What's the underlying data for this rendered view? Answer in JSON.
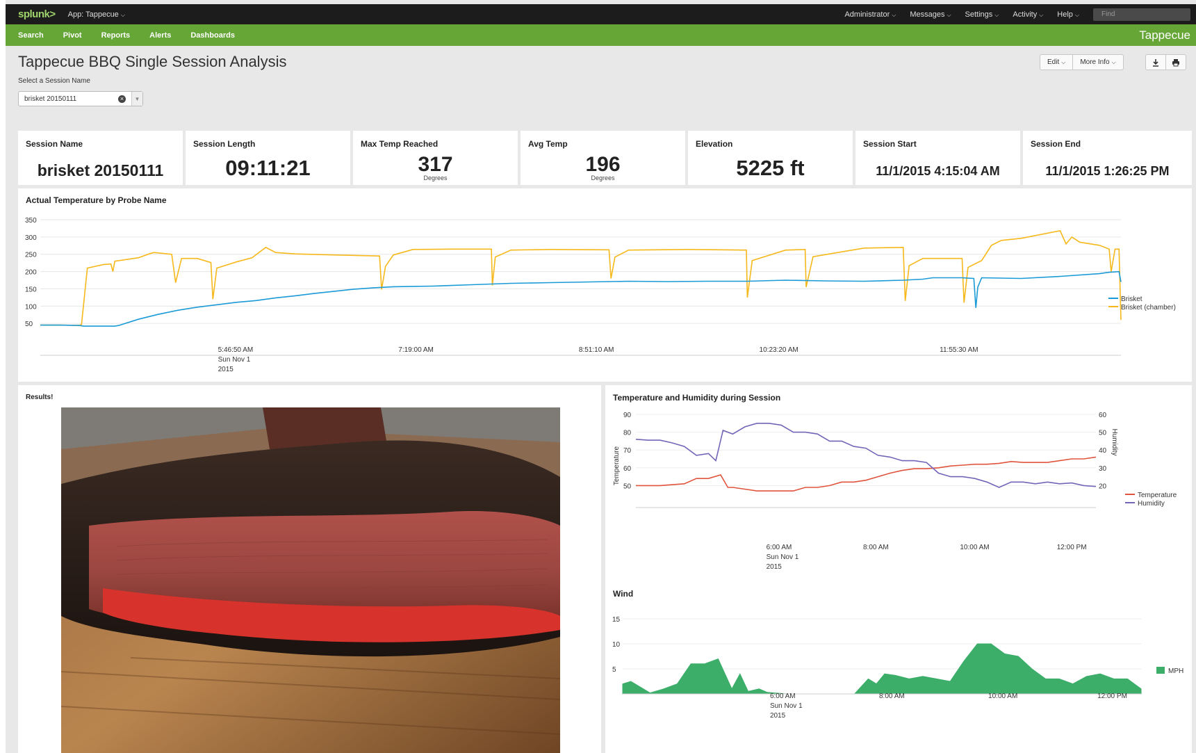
{
  "topbar": {
    "logo": "splunk",
    "logo_mark": ">",
    "app_label": "App: Tappecue",
    "menus": [
      "Administrator",
      "Messages",
      "Settings",
      "Activity",
      "Help"
    ],
    "find_placeholder": "Find"
  },
  "appnav": {
    "items": [
      "Search",
      "Pivot",
      "Reports",
      "Alerts",
      "Dashboards"
    ],
    "brand": "Tappecue"
  },
  "page": {
    "title": "Tappecue BBQ Single Session Analysis",
    "select_label": "Select a Session Name",
    "select_value": "brisket 20150111",
    "edit_label": "Edit",
    "more_info_label": "More Info"
  },
  "stats": [
    {
      "label": "Session Name",
      "value": "brisket 20150111",
      "sub": ""
    },
    {
      "label": "Session Length",
      "value": "09:11:21",
      "sub": ""
    },
    {
      "label": "Max Temp Reached",
      "value": "317",
      "sub": "Degrees"
    },
    {
      "label": "Avg Temp",
      "value": "196",
      "sub": "Degrees"
    },
    {
      "label": "Elevation",
      "value": "5225 ft",
      "sub": ""
    },
    {
      "label": "Session Start",
      "value": "11/1/2015 4:15:04 AM",
      "sub": ""
    },
    {
      "label": "Session End",
      "value": "11/1/2015 1:26:25 PM",
      "sub": ""
    }
  ],
  "results_title": "Results!",
  "colors": {
    "brisket": "#1a9ad6",
    "chamber": "#f6b81a",
    "temperature": "#e0533c",
    "humidity": "#7464b8",
    "wind": "#3cae6a",
    "green_nav": "#65a637"
  },
  "chart_data": [
    {
      "type": "line",
      "title": "Actual Temperature by Probe Name",
      "xlabel": "",
      "ylabel": "",
      "y_ticks": [
        50,
        100,
        150,
        200,
        250,
        300,
        350
      ],
      "ylim": [
        0,
        350
      ],
      "x_tick_labels": [
        {
          "t": 92,
          "lines": [
            "5:46:50 AM",
            "Sun Nov 1",
            "2015"
          ]
        },
        {
          "t": 184,
          "lines": [
            "7:19:00 AM"
          ]
        },
        {
          "t": 276,
          "lines": [
            "8:51:10 AM"
          ]
        },
        {
          "t": 368,
          "lines": [
            "10:23:20 AM"
          ]
        },
        {
          "t": 460,
          "lines": [
            "11:55:30 AM"
          ]
        }
      ],
      "x_range": [
        0,
        551
      ],
      "legend_position": "right",
      "series": [
        {
          "name": "Brisket",
          "x": [
            0,
            10,
            20,
            22,
            30,
            38,
            40,
            50,
            60,
            70,
            80,
            90,
            100,
            110,
            120,
            130,
            140,
            150,
            160,
            170,
            180,
            190,
            200,
            220,
            240,
            260,
            280,
            300,
            320,
            340,
            360,
            380,
            400,
            420,
            440,
            450,
            455,
            470,
            476,
            477,
            478,
            480,
            500,
            520,
            540,
            545,
            548,
            550,
            551
          ],
          "y": [
            45,
            45,
            44,
            42,
            42,
            42,
            44,
            62,
            76,
            88,
            97,
            104,
            111,
            116,
            124,
            130,
            137,
            143,
            149,
            153,
            156,
            157,
            158,
            162,
            166,
            168,
            170,
            172,
            171,
            172,
            172,
            175,
            173,
            172,
            175,
            178,
            182,
            182,
            180,
            95,
            155,
            182,
            180,
            186,
            194,
            198,
            199,
            200,
            170
          ]
        },
        {
          "name": "Brisket (chamber)",
          "x": [
            0,
            10,
            20,
            21,
            24,
            32,
            36,
            37,
            38,
            50,
            56,
            58,
            67,
            69,
            72,
            80,
            87,
            88,
            90,
            100,
            108,
            115,
            120,
            130,
            150,
            173,
            174,
            176,
            180,
            190,
            210,
            230,
            230.5,
            232,
            240,
            260,
            290,
            291,
            293,
            300,
            330,
            360,
            360.5,
            363,
            380,
            390,
            390.5,
            394,
            420,
            440,
            441,
            443,
            450,
            460,
            470,
            471,
            473,
            480,
            485,
            490,
            500,
            520,
            523,
            526,
            530,
            540,
            545,
            546,
            548,
            550,
            551
          ],
          "y": [
            45,
            45,
            44,
            47,
            210,
            220,
            222,
            200,
            230,
            240,
            252,
            255,
            250,
            168,
            238,
            238,
            226,
            120,
            210,
            228,
            240,
            270,
            255,
            251,
            248,
            245,
            148,
            215,
            248,
            264,
            265,
            265,
            160,
            242,
            262,
            264,
            263,
            180,
            242,
            262,
            264,
            262,
            125,
            232,
            262,
            264,
            155,
            243,
            268,
            270,
            115,
            217,
            238,
            238,
            238,
            110,
            212,
            232,
            276,
            290,
            296,
            318,
            280,
            300,
            285,
            276,
            265,
            200,
            265,
            265,
            60
          ]
        }
      ]
    },
    {
      "type": "line",
      "title": "Temperature and Humidity during Session",
      "xlabel": "",
      "ylabel": "Temperature",
      "ylabel_right": "Humidity",
      "y_ticks_left": [
        50,
        60,
        70,
        80,
        90
      ],
      "y_ticks_right": [
        20,
        30,
        40,
        50,
        60
      ],
      "ylim_left": [
        40,
        90
      ],
      "ylim_right": [
        10,
        60
      ],
      "x_tick_labels": [
        {
          "t": 5.5,
          "lines": [
            "6:00 AM",
            "Sun Nov 1",
            "2015"
          ]
        },
        {
          "t": 9.5,
          "lines": [
            "8:00 AM"
          ]
        },
        {
          "t": 13.5,
          "lines": [
            "10:00 AM"
          ]
        },
        {
          "t": 17.5,
          "lines": [
            "12:00 PM"
          ]
        }
      ],
      "x_range": [
        0,
        19
      ],
      "legend_position": "right",
      "series": [
        {
          "name": "Temperature",
          "x": [
            0,
            0.5,
            1,
            1.5,
            2,
            2.5,
            3,
            3.5,
            3.8,
            4,
            4.5,
            5,
            5.5,
            6,
            6.5,
            7,
            7.5,
            8,
            8.5,
            9,
            9.5,
            10,
            10.5,
            11,
            11.5,
            12,
            12.5,
            13,
            13.5,
            14,
            14.5,
            15,
            15.5,
            16,
            16.5,
            17,
            17.5,
            18,
            18.5,
            19
          ],
          "y": [
            50,
            50,
            50,
            50.5,
            51,
            54,
            54,
            56,
            49,
            49,
            48,
            47,
            47,
            47,
            47,
            49,
            49,
            50,
            52,
            52,
            53,
            55,
            57,
            58.5,
            59.5,
            59.5,
            60,
            61,
            61.5,
            62,
            62,
            62.5,
            63.5,
            63,
            63,
            63,
            64,
            65,
            65,
            66
          ]
        },
        {
          "name": "Humidity",
          "x": [
            0,
            0.5,
            1,
            1.5,
            2,
            2.5,
            3,
            3.3,
            3.6,
            4,
            4.5,
            5,
            5.5,
            6,
            6.5,
            7,
            7.5,
            8,
            8.5,
            9,
            9.5,
            10,
            10.5,
            11,
            11.5,
            12,
            12.5,
            13,
            13.5,
            14,
            14.5,
            15,
            15.5,
            16,
            16.5,
            17,
            17.5,
            18,
            18.5,
            19
          ],
          "y": [
            46,
            45.5,
            45.5,
            44,
            42,
            37,
            38,
            34,
            51,
            49,
            53,
            55,
            55,
            54,
            50,
            50,
            49,
            45,
            45,
            42,
            41,
            37,
            36,
            34,
            34,
            33,
            27,
            25,
            25,
            24,
            22,
            19,
            22,
            22,
            21,
            22,
            21,
            21.5,
            20,
            19.5
          ]
        }
      ]
    },
    {
      "type": "area",
      "title": "Wind",
      "xlabel": "",
      "ylabel": "",
      "y_ticks": [
        5,
        10,
        15
      ],
      "ylim": [
        0,
        15
      ],
      "x_tick_labels": [
        {
          "t": 5.5,
          "lines": [
            "6:00 AM",
            "Sun Nov 1",
            "2015"
          ]
        },
        {
          "t": 9.5,
          "lines": [
            "8:00 AM"
          ]
        },
        {
          "t": 13.5,
          "lines": [
            "10:00 AM"
          ]
        },
        {
          "t": 17.5,
          "lines": [
            "12:00 PM"
          ]
        }
      ],
      "x_range": [
        0,
        19
      ],
      "legend_position": "right",
      "series": [
        {
          "name": "MPH",
          "x": [
            0,
            0.3,
            0.7,
            1,
            1.5,
            2,
            2.5,
            3,
            3.5,
            4,
            4.3,
            4.6,
            5,
            5.3,
            6,
            6.5,
            7,
            7.5,
            8,
            8.5,
            9,
            9.3,
            9.6,
            10,
            10.5,
            11,
            11.5,
            12,
            12.5,
            13,
            13.5,
            14,
            14.5,
            15,
            15.5,
            16,
            16.5,
            17,
            17.5,
            18,
            18.5,
            19
          ],
          "y": [
            2,
            2.5,
            1.2,
            0.2,
            1,
            2,
            6,
            6,
            7,
            1,
            4,
            0.5,
            1,
            0.3,
            0,
            0,
            0,
            0,
            0,
            0,
            3,
            2,
            4,
            3.7,
            3,
            3.5,
            3,
            2.5,
            6.5,
            10,
            10,
            8,
            7.5,
            5,
            3,
            3,
            2,
            3.5,
            4,
            3,
            3,
            1
          ]
        }
      ]
    }
  ]
}
